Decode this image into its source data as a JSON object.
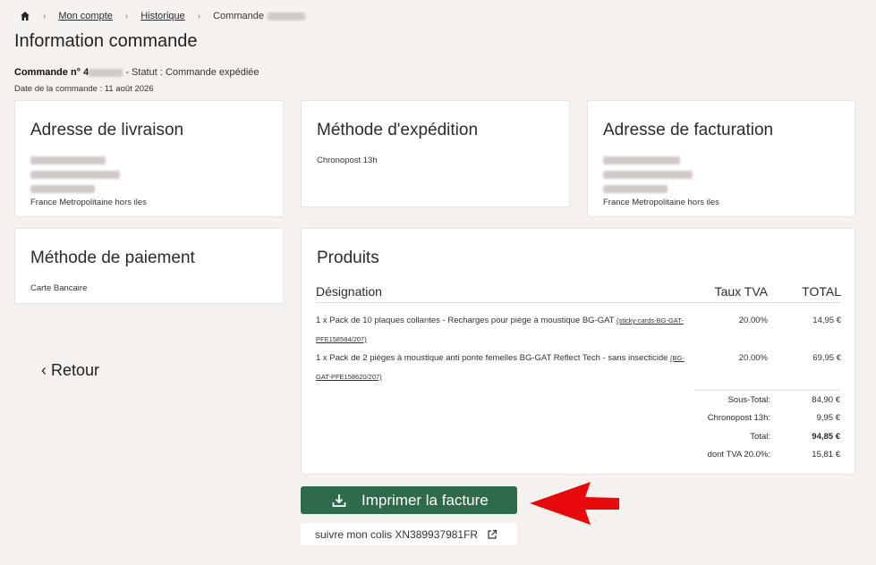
{
  "breadcrumb": {
    "account": "Mon compte",
    "history": "Historique",
    "current": "Commande"
  },
  "page_title": "Information commande",
  "order": {
    "label": "Commande n°",
    "number_partial": "4",
    "status": "- Statut : Commande expédiée",
    "date": "Date de la commande : 11 août 2026"
  },
  "shipping_address": {
    "title": "Adresse de livraison",
    "country": "France Metropolitaine hors iles"
  },
  "shipping_method": {
    "title": "Méthode d'expédition",
    "value": "Chronopost 13h"
  },
  "billing_address": {
    "title": "Adresse de facturation",
    "country": "France Metropolitaine hors iles"
  },
  "payment": {
    "title": "Méthode de paiement",
    "value": "Carte Bancaire"
  },
  "back_label": "Retour",
  "products": {
    "title": "Produits",
    "headers": {
      "designation": "Désignation",
      "vat": "Taux TVA",
      "total": "TOTAL"
    },
    "items": [
      {
        "desc": "1 x Pack de 10 plaques collantes - Recharges pour piège à moustique BG-GAT",
        "ref": "(sticky-cards-BG-GAT-PFE158584/207)",
        "vat": "20.00%",
        "total": "14,95 €"
      },
      {
        "desc": "1 x Pack de 2 pièges à moustique anti ponte femelles BG-GAT Reflect Tech - sans insecticide",
        "ref": "(BG-GAT-PFE158620/207)",
        "vat": "20.00%",
        "total": "69,95 €"
      }
    ],
    "totals": [
      {
        "label": "Sous-Total:",
        "value": "84,90 €"
      },
      {
        "label": "Chronopost 13h:",
        "value": "9,95 €"
      },
      {
        "label": "Total:",
        "value": "94,85 €"
      },
      {
        "label": "dont TVA 20.0%:",
        "value": "15,81 €"
      }
    ]
  },
  "print_button": "Imprimer la facture",
  "tracking": "suivre mon colis XN389937981FR",
  "colors": {
    "background": "#f5f1ee",
    "button": "#2e6b4a",
    "arrow": "#e8090d"
  }
}
